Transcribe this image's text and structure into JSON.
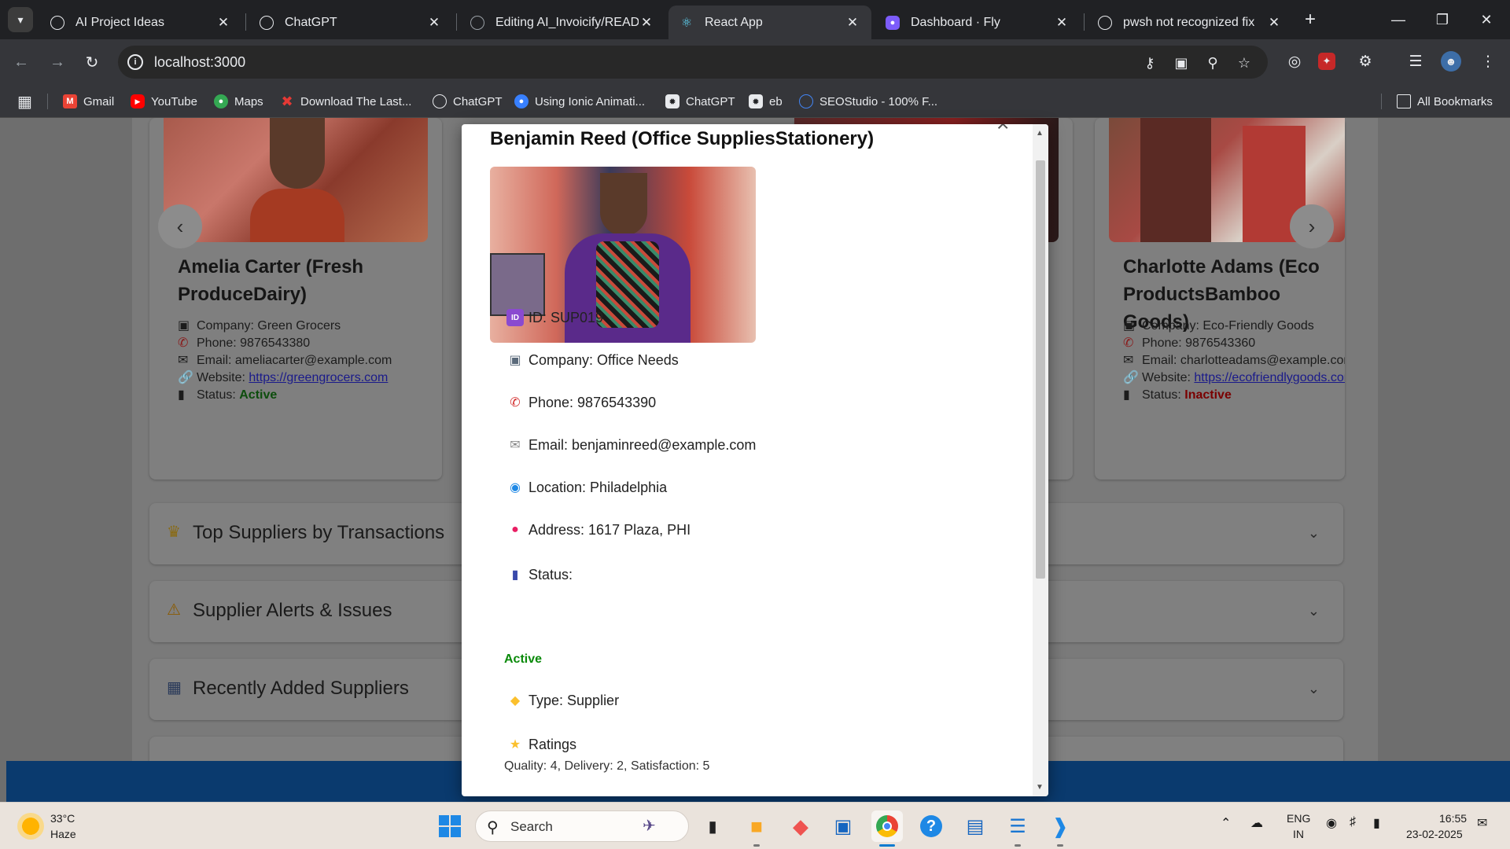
{
  "browser": {
    "tabs": [
      {
        "title": "AI Project Ideas",
        "active": false
      },
      {
        "title": "ChatGPT",
        "active": false
      },
      {
        "title": "Editing AI_Invoicify/README",
        "active": false
      },
      {
        "title": "React App",
        "active": true
      },
      {
        "title": "Dashboard · Fly",
        "active": false
      },
      {
        "title": "pwsh not recognized fix",
        "active": false
      }
    ],
    "url": "localhost:3000",
    "bookmarks": [
      "Gmail",
      "YouTube",
      "Maps",
      "Download The Last...",
      "ChatGPT",
      "Using Ionic Animati...",
      "ChatGPT",
      "eb",
      "SEOStudio - 100% F...",
      "All Bookmarks"
    ]
  },
  "cards": [
    {
      "name": "Amelia Carter (Fresh ProduceDairy)",
      "company_label": "Company: Green Grocers",
      "phone_label": "Phone: 9876543380",
      "email_label": "Email: ameliacarter@example.com",
      "website_prefix": "Website: ",
      "website": "https://greengrocers.com",
      "status_prefix": "Status: ",
      "status": "Active"
    },
    {
      "name": "Charlotte Adams (Eco ProductsBamboo Goods)",
      "company_label": "Company: Eco-Friendly Goods",
      "phone_label": "Phone: 9876543360",
      "email_label": "Email: charlotteadams@example.com",
      "website_prefix": "Website: ",
      "website": "https://ecofriendlygoods.com",
      "status_prefix": "Status: ",
      "status": "Inactive"
    }
  ],
  "sections": [
    {
      "label": "Top Suppliers by Transactions",
      "icon": "trophy-icon"
    },
    {
      "label": "Supplier Alerts & Issues",
      "icon": "warning-icon"
    },
    {
      "label": "Recently Added Suppliers",
      "icon": "calendar-icon"
    }
  ],
  "modal": {
    "title": "Benjamin Reed (Office SuppliesStationery)",
    "id": "ID: SUP019",
    "company": "Company: Office Needs",
    "phone": "Phone: 9876543390",
    "email": "Email: benjaminreed@example.com",
    "location": "Location: Philadelphia",
    "address": "Address: 1617 Plaza, PHI",
    "status_label": "Status:",
    "status": "Active",
    "type": "Type: Supplier",
    "ratings_label": "Ratings",
    "ratings": "Quality: 4, Delivery: 2, Satisfaction: 5"
  },
  "taskbar": {
    "weather_temp": "33°C",
    "weather_desc": "Haze",
    "search_label": "Search",
    "lang": "ENG",
    "region": "IN",
    "time": "16:55",
    "date": "23-02-2025"
  },
  "colors": {
    "status_active": "#0a8a0a",
    "status_inactive": "#b00000",
    "page_overlay": "#6e6e6e",
    "taskbar": "#eae3dc"
  }
}
